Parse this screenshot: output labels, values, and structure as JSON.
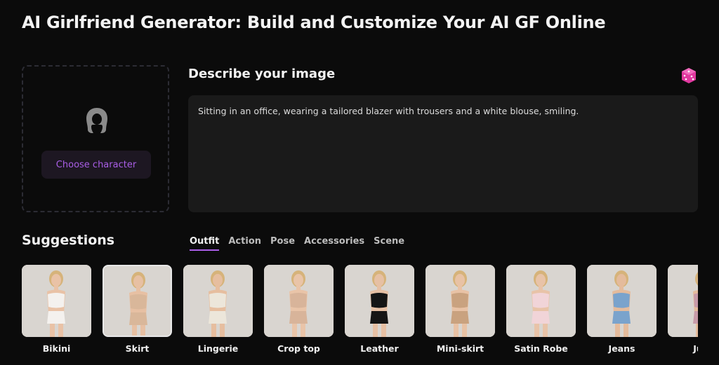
{
  "page": {
    "title": "AI Girlfriend Generator: Build and Customize Your AI GF Online"
  },
  "character": {
    "avatar_icon": "female-avatar-icon",
    "button_label": "Choose character",
    "accent": "#a95ee6"
  },
  "describe": {
    "title": "Describe your image",
    "dice_icon": "random-dice-icon",
    "dice_color": "#e0389f",
    "prompt": "Sitting in an office, wearing a tailored blazer with trousers and a white blouse, smiling."
  },
  "suggestions": {
    "title": "Suggestions",
    "tabs": [
      {
        "label": "Outfit",
        "active": true
      },
      {
        "label": "Action",
        "active": false
      },
      {
        "label": "Pose",
        "active": false
      },
      {
        "label": "Accessories",
        "active": false
      },
      {
        "label": "Scene",
        "active": false
      }
    ],
    "items": [
      {
        "label": "Bikini",
        "selected": false,
        "outfit": "#f4f1ee",
        "skin": "#e9c2a6"
      },
      {
        "label": "Skirt",
        "selected": true,
        "outfit": "#d9b79a",
        "skin": "#e7c0a3"
      },
      {
        "label": "Lingerie",
        "selected": false,
        "outfit": "#ece6da",
        "skin": "#e6be9f"
      },
      {
        "label": "Crop top",
        "selected": false,
        "outfit": "#d8b49a",
        "skin": "#e9c4a8"
      },
      {
        "label": "Leather",
        "selected": false,
        "outfit": "#151515",
        "skin": "#e6c0a4"
      },
      {
        "label": "Mini-skirt",
        "selected": false,
        "outfit": "#c9a27f",
        "skin": "#e8c2a5"
      },
      {
        "label": "Satin Robe",
        "selected": false,
        "outfit": "#f1d4d8",
        "skin": "#e8c3a8"
      },
      {
        "label": "Jeans",
        "selected": false,
        "outfit": "#7aa3cc",
        "skin": "#e4bb9c"
      },
      {
        "label": "Jum",
        "selected": false,
        "outfit": "#c79aa8",
        "skin": "#e4bb9c"
      }
    ]
  }
}
